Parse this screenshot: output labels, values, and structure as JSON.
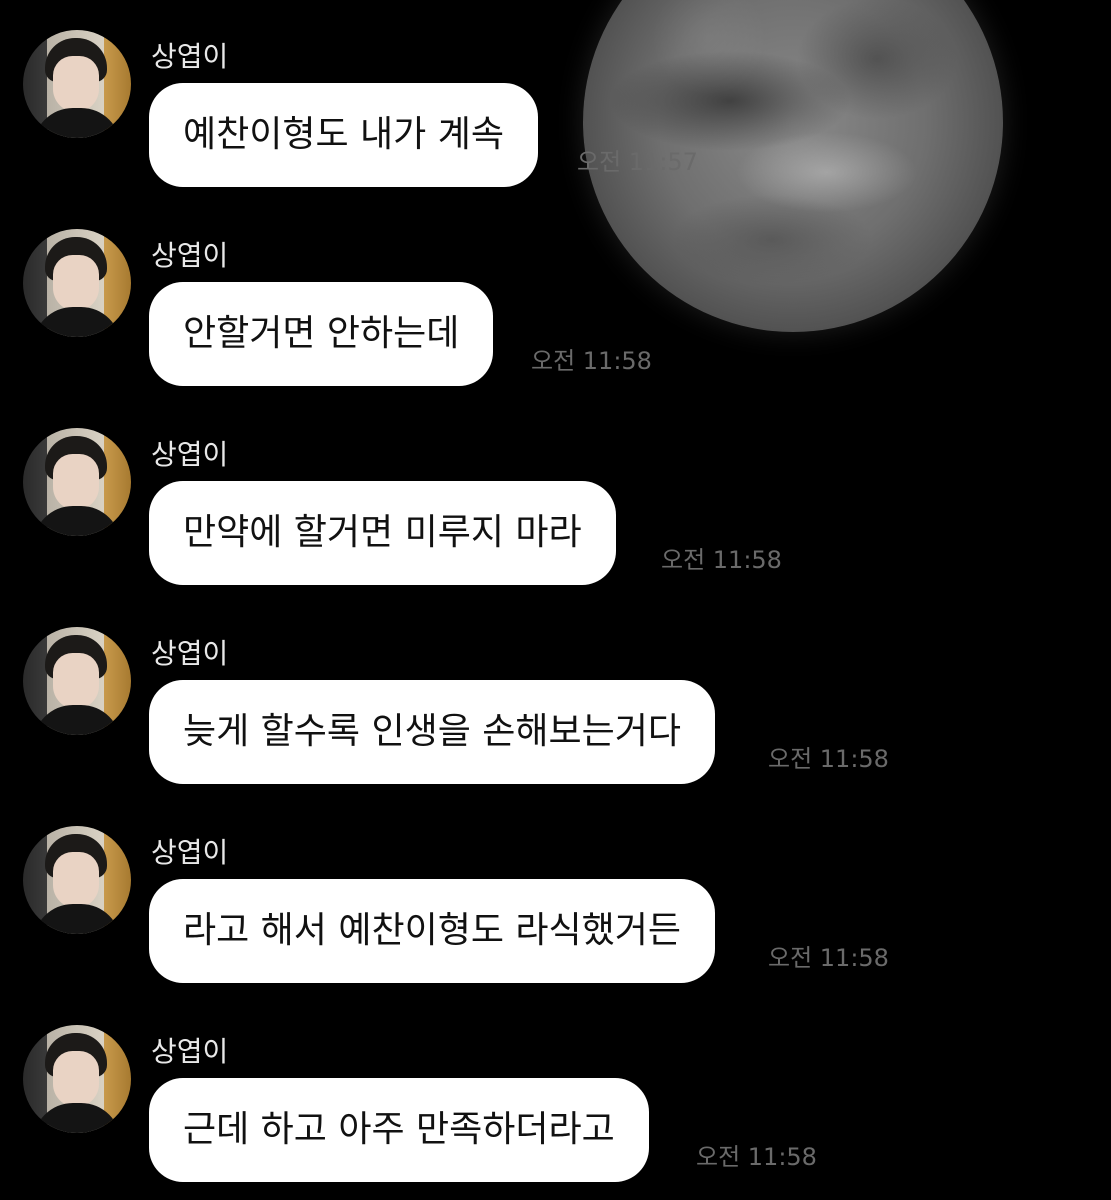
{
  "messages": [
    {
      "sender": "상엽이",
      "text": "예찬이형도 내가 계속",
      "time": "오전 11:57"
    },
    {
      "sender": "상엽이",
      "text": "안할거면 안하는데",
      "time": "오전 11:58"
    },
    {
      "sender": "상엽이",
      "text": "만약에 할거면 미루지 마라",
      "time": "오전 11:58"
    },
    {
      "sender": "상엽이",
      "text": "늦게 할수록 인생을 손해보는거다",
      "time": "오전 11:58"
    },
    {
      "sender": "상엽이",
      "text": "라고 해서 예찬이형도 라식했거든",
      "time": "오전 11:58"
    },
    {
      "sender": "상엽이",
      "text": "근데 하고 아주 만족하더라고",
      "time": "오전 11:58"
    }
  ],
  "colors": {
    "background": "#000000",
    "bubble": "#ffffff",
    "name": "#e8e8e8",
    "time": "#6a6a6a"
  },
  "icons": {
    "avatar": "profile-photo"
  }
}
